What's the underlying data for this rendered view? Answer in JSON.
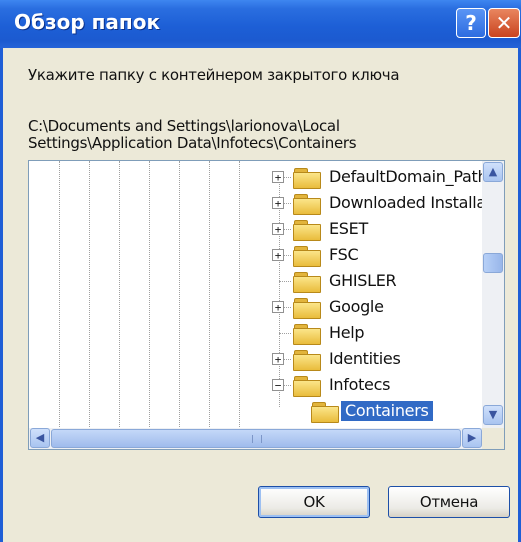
{
  "window": {
    "title": "Обзор папок",
    "help_label": "?",
    "close_label": "✕"
  },
  "prompt": "Укажите папку с контейнером закрытого ключа",
  "path": {
    "line1": "C:\\Documents and Settings\\larionova\\Local",
    "line2": "Settings\\Application Data\\Infotecs\\Containers"
  },
  "tree": {
    "items": [
      {
        "label": "DefaultDomain_Path",
        "expander": "+",
        "selected": false
      },
      {
        "label": "Downloaded Installat",
        "expander": "+",
        "selected": false
      },
      {
        "label": "ESET",
        "expander": "+",
        "selected": false
      },
      {
        "label": "FSC",
        "expander": "+",
        "selected": false
      },
      {
        "label": "GHISLER",
        "expander": "",
        "selected": false
      },
      {
        "label": "Google",
        "expander": "+",
        "selected": false
      },
      {
        "label": "Help",
        "expander": "",
        "selected": false
      },
      {
        "label": "Identities",
        "expander": "+",
        "selected": false
      },
      {
        "label": "Infotecs",
        "expander": "−",
        "selected": false
      },
      {
        "label": "Containers",
        "expander": "",
        "selected": true
      }
    ]
  },
  "scroll": {
    "up": "▲",
    "down": "▼",
    "left": "◀",
    "right": "▶"
  },
  "buttons": {
    "ok": "OK",
    "cancel": "Отмена"
  },
  "colors": {
    "titlebar": "#1f5ed6",
    "selection": "#316ac5",
    "folder": "#f5d163"
  }
}
